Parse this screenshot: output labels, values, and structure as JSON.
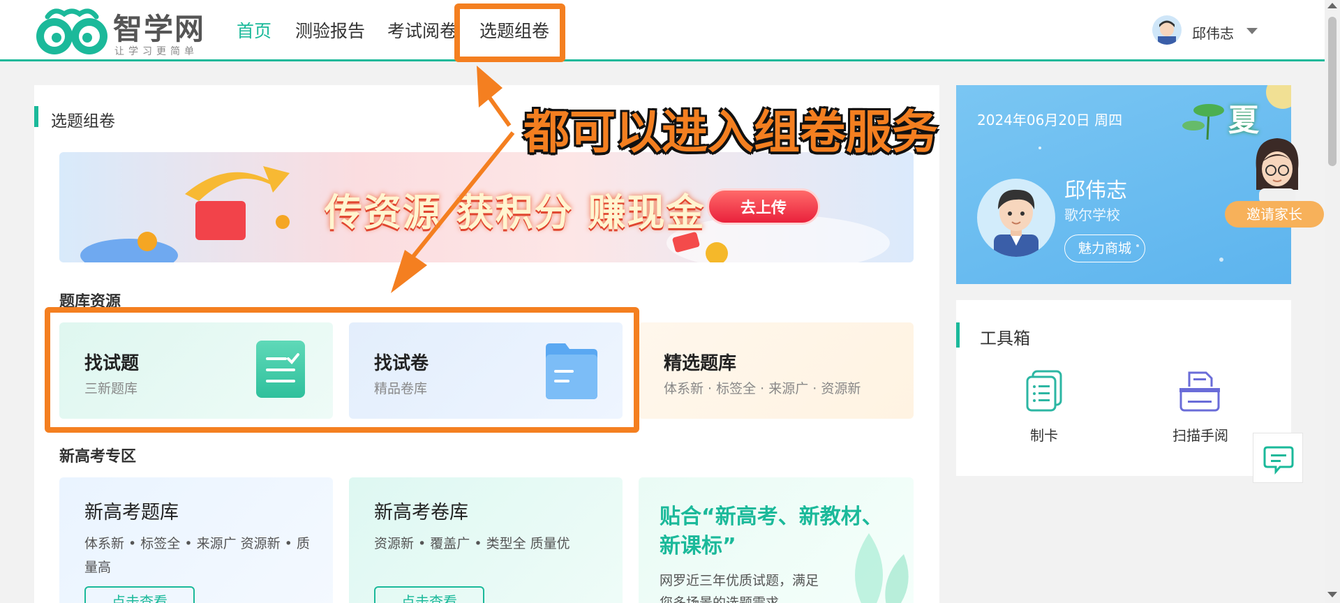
{
  "header": {
    "logo_name": "智学网",
    "logo_slogan": "让学习更简单",
    "nav": [
      "首页",
      "测验报告",
      "考试阅卷",
      "选题组卷"
    ],
    "user_name": "邱伟志"
  },
  "main": {
    "section_title": "选题组卷",
    "banner": {
      "headline": "传资源 获积分 赚现金",
      "button": "去上传"
    },
    "tiku": {
      "title": "题库资源",
      "cards": [
        {
          "title": "找试题",
          "subtitle": "三新题库"
        },
        {
          "title": "找试卷",
          "subtitle": "精品卷库"
        },
        {
          "title": "精选题库",
          "subtitle": "体系新 · 标签全 · 来源广 · 资源新"
        }
      ]
    },
    "xingaokao": {
      "title": "新高考专区",
      "cards": [
        {
          "title": "新高考题库",
          "tags": "体系新 • 标签全 • 来源广 资源新 • 质量高",
          "button": "点击查看"
        },
        {
          "title": "新高考卷库",
          "tags": "资源新 • 覆盖广 • 类型全 质量优",
          "button": "点击查看"
        },
        {
          "title": "贴合“新高考、新教材、新课标”",
          "desc": "网罗近三年优质试题，满足您多场景的选题需求"
        }
      ]
    }
  },
  "profile": {
    "date": "2024年06月20日 周四",
    "season": "夏",
    "name": "邱伟志",
    "school": "歌尔学校",
    "shop_button": "魅力商城",
    "invite_button": "邀请家长"
  },
  "tools": {
    "title": "工具箱",
    "items": [
      {
        "label": "制卡",
        "icon": "card-icon"
      },
      {
        "label": "扫描手阅",
        "icon": "scan-icon"
      }
    ]
  },
  "annotation": {
    "text": "都可以进入组卷服务"
  },
  "colors": {
    "accent": "#1bb99a",
    "annotation": "#f47f20",
    "profile_bg": "#6bbdf1"
  }
}
